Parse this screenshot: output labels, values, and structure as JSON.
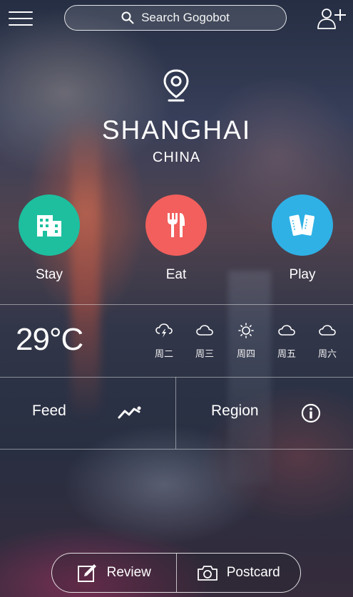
{
  "header": {
    "search_placeholder": "Search Gogobot",
    "menu_icon": "hamburger-menu-icon",
    "add_user_icon": "add-user-icon"
  },
  "location": {
    "city": "SHANGHAI",
    "country": "CHINA",
    "pin_icon": "location-pin-icon"
  },
  "categories": [
    {
      "label": "Stay",
      "icon": "hotel-icon",
      "color": "#1dbf9f"
    },
    {
      "label": "Eat",
      "icon": "fork-knife-icon",
      "color": "#f25f5c"
    },
    {
      "label": "Play",
      "icon": "tickets-icon",
      "color": "#2fb1e6"
    }
  ],
  "weather": {
    "temp_value": "29",
    "temp_unit": "°C",
    "forecast": [
      {
        "day": "周二",
        "icon": "thunderstorm-icon"
      },
      {
        "day": "周三",
        "icon": "cloud-icon"
      },
      {
        "day": "周四",
        "icon": "sun-icon"
      },
      {
        "day": "周五",
        "icon": "cloud-icon"
      },
      {
        "day": "周六",
        "icon": "cloud-icon"
      }
    ]
  },
  "links": {
    "feed": "Feed",
    "feed_icon": "trend-line-icon",
    "region": "Region",
    "region_icon": "info-icon"
  },
  "actions": {
    "review": "Review",
    "review_icon": "edit-icon",
    "postcard": "Postcard",
    "postcard_icon": "camera-icon"
  }
}
